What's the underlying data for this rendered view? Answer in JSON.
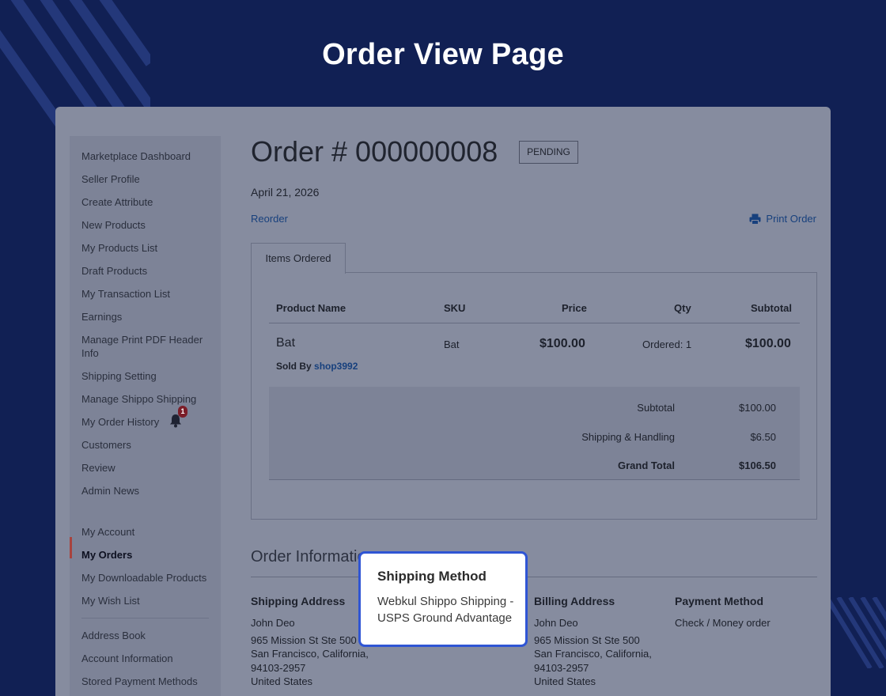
{
  "banner": {
    "title": "Order View Page"
  },
  "sidebar": {
    "items": [
      "Marketplace Dashboard",
      "Seller Profile",
      "Create Attribute",
      "New Products",
      "My Products List",
      "Draft Products",
      "My Transaction List",
      "Earnings",
      "Manage Print PDF Header Info",
      "Shipping Setting",
      "Manage Shippo Shipping",
      "My Order History",
      "Customers",
      "Review",
      "Admin News"
    ],
    "notification_count": "1",
    "account_items": [
      "My Account",
      "My Orders",
      "My Downloadable Products",
      "My Wish List"
    ],
    "active_item": "My Orders",
    "settings_items": [
      "Address Book",
      "Account Information",
      "Stored Payment Methods"
    ]
  },
  "order": {
    "title": "Order # 000000008",
    "status": "PENDING",
    "date": "April 21, 2026",
    "reorder_label": "Reorder",
    "print_label": "Print Order"
  },
  "items_tab": {
    "label": "Items Ordered"
  },
  "items_table": {
    "headers": {
      "product": "Product Name",
      "sku": "SKU",
      "price": "Price",
      "qty": "Qty",
      "subtotal": "Subtotal"
    },
    "rows": [
      {
        "name": "Bat",
        "sku": "Bat",
        "price": "$100.00",
        "qty": "Ordered: 1",
        "subtotal": "$100.00",
        "sold_by_label": "Sold By",
        "seller": "shop3992"
      }
    ]
  },
  "totals": [
    {
      "label": "Subtotal",
      "value": "$100.00"
    },
    {
      "label": "Shipping & Handling",
      "value": "$6.50"
    },
    {
      "label": "Grand Total",
      "value": "$106.50"
    }
  ],
  "order_information": {
    "heading": "Order Information",
    "shipping_address": {
      "heading": "Shipping Address",
      "lines": [
        "John Deo",
        "965 Mission St Ste 500",
        "San Francisco, California,",
        "94103-2957",
        "United States"
      ]
    },
    "billing_address": {
      "heading": "Billing Address",
      "lines": [
        "John Deo",
        "965 Mission St Ste 500",
        "San Francisco, California,",
        "94103-2957",
        "United States"
      ]
    },
    "payment_method": {
      "heading": "Payment Method",
      "value": "Check / Money order"
    }
  },
  "callout": {
    "title": "Shipping Method",
    "text": "Webkul Shippo Shipping - USPS Ground Advantage"
  },
  "colors": {
    "background": "#112054",
    "accent_link": "#17407d",
    "callout_border": "#2f55d4",
    "active_marker": "#a8433e"
  }
}
